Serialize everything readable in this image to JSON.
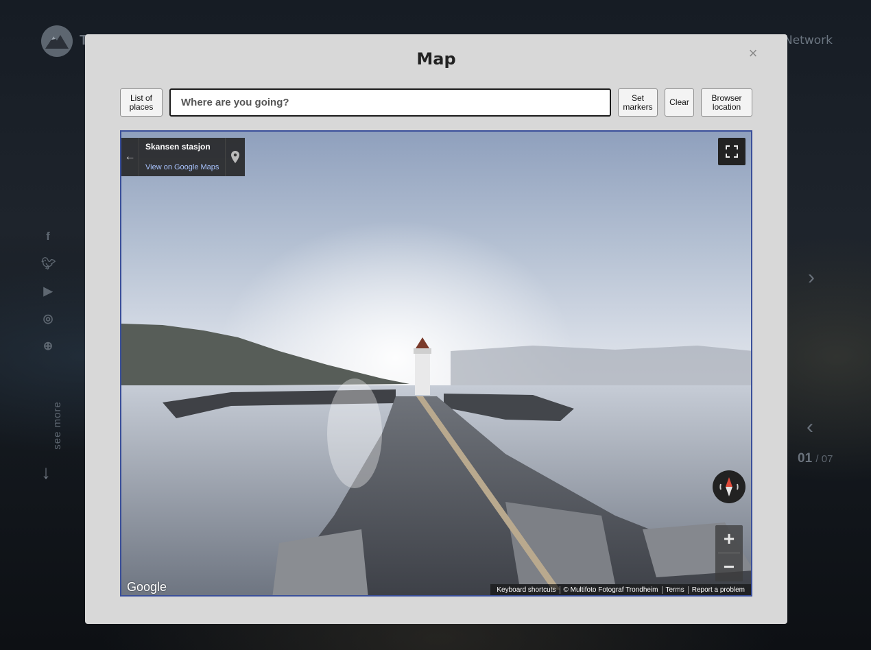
{
  "background": {
    "logo_letter": "T",
    "nav_item": "Network",
    "social_icons": [
      "facebook-icon",
      "twitter-icon",
      "youtube-icon",
      "instagram-icon",
      "dribbble-icon"
    ],
    "see_more": "see more",
    "counter_current": "01",
    "counter_total": "/ 07"
  },
  "modal": {
    "title": "Map",
    "close_icon": "×"
  },
  "toolbar": {
    "list_places": "List of places",
    "search_placeholder": "Where are you going?",
    "set_markers": "Set markers",
    "clear": "Clear",
    "browser_location": "Browser location"
  },
  "street_view": {
    "place_name": "Skansen stasjon",
    "view_link": "View on Google Maps",
    "google_logo": "Google",
    "footer": {
      "shortcuts": "Keyboard shortcuts",
      "copyright": "© Multifoto Fotograf Trondheim",
      "terms": "Terms",
      "report": "Report a problem"
    }
  },
  "colors": {
    "modal_bg": "#d8d8d8",
    "map_border": "#3a4f9a",
    "link": "#a9c4ff"
  }
}
